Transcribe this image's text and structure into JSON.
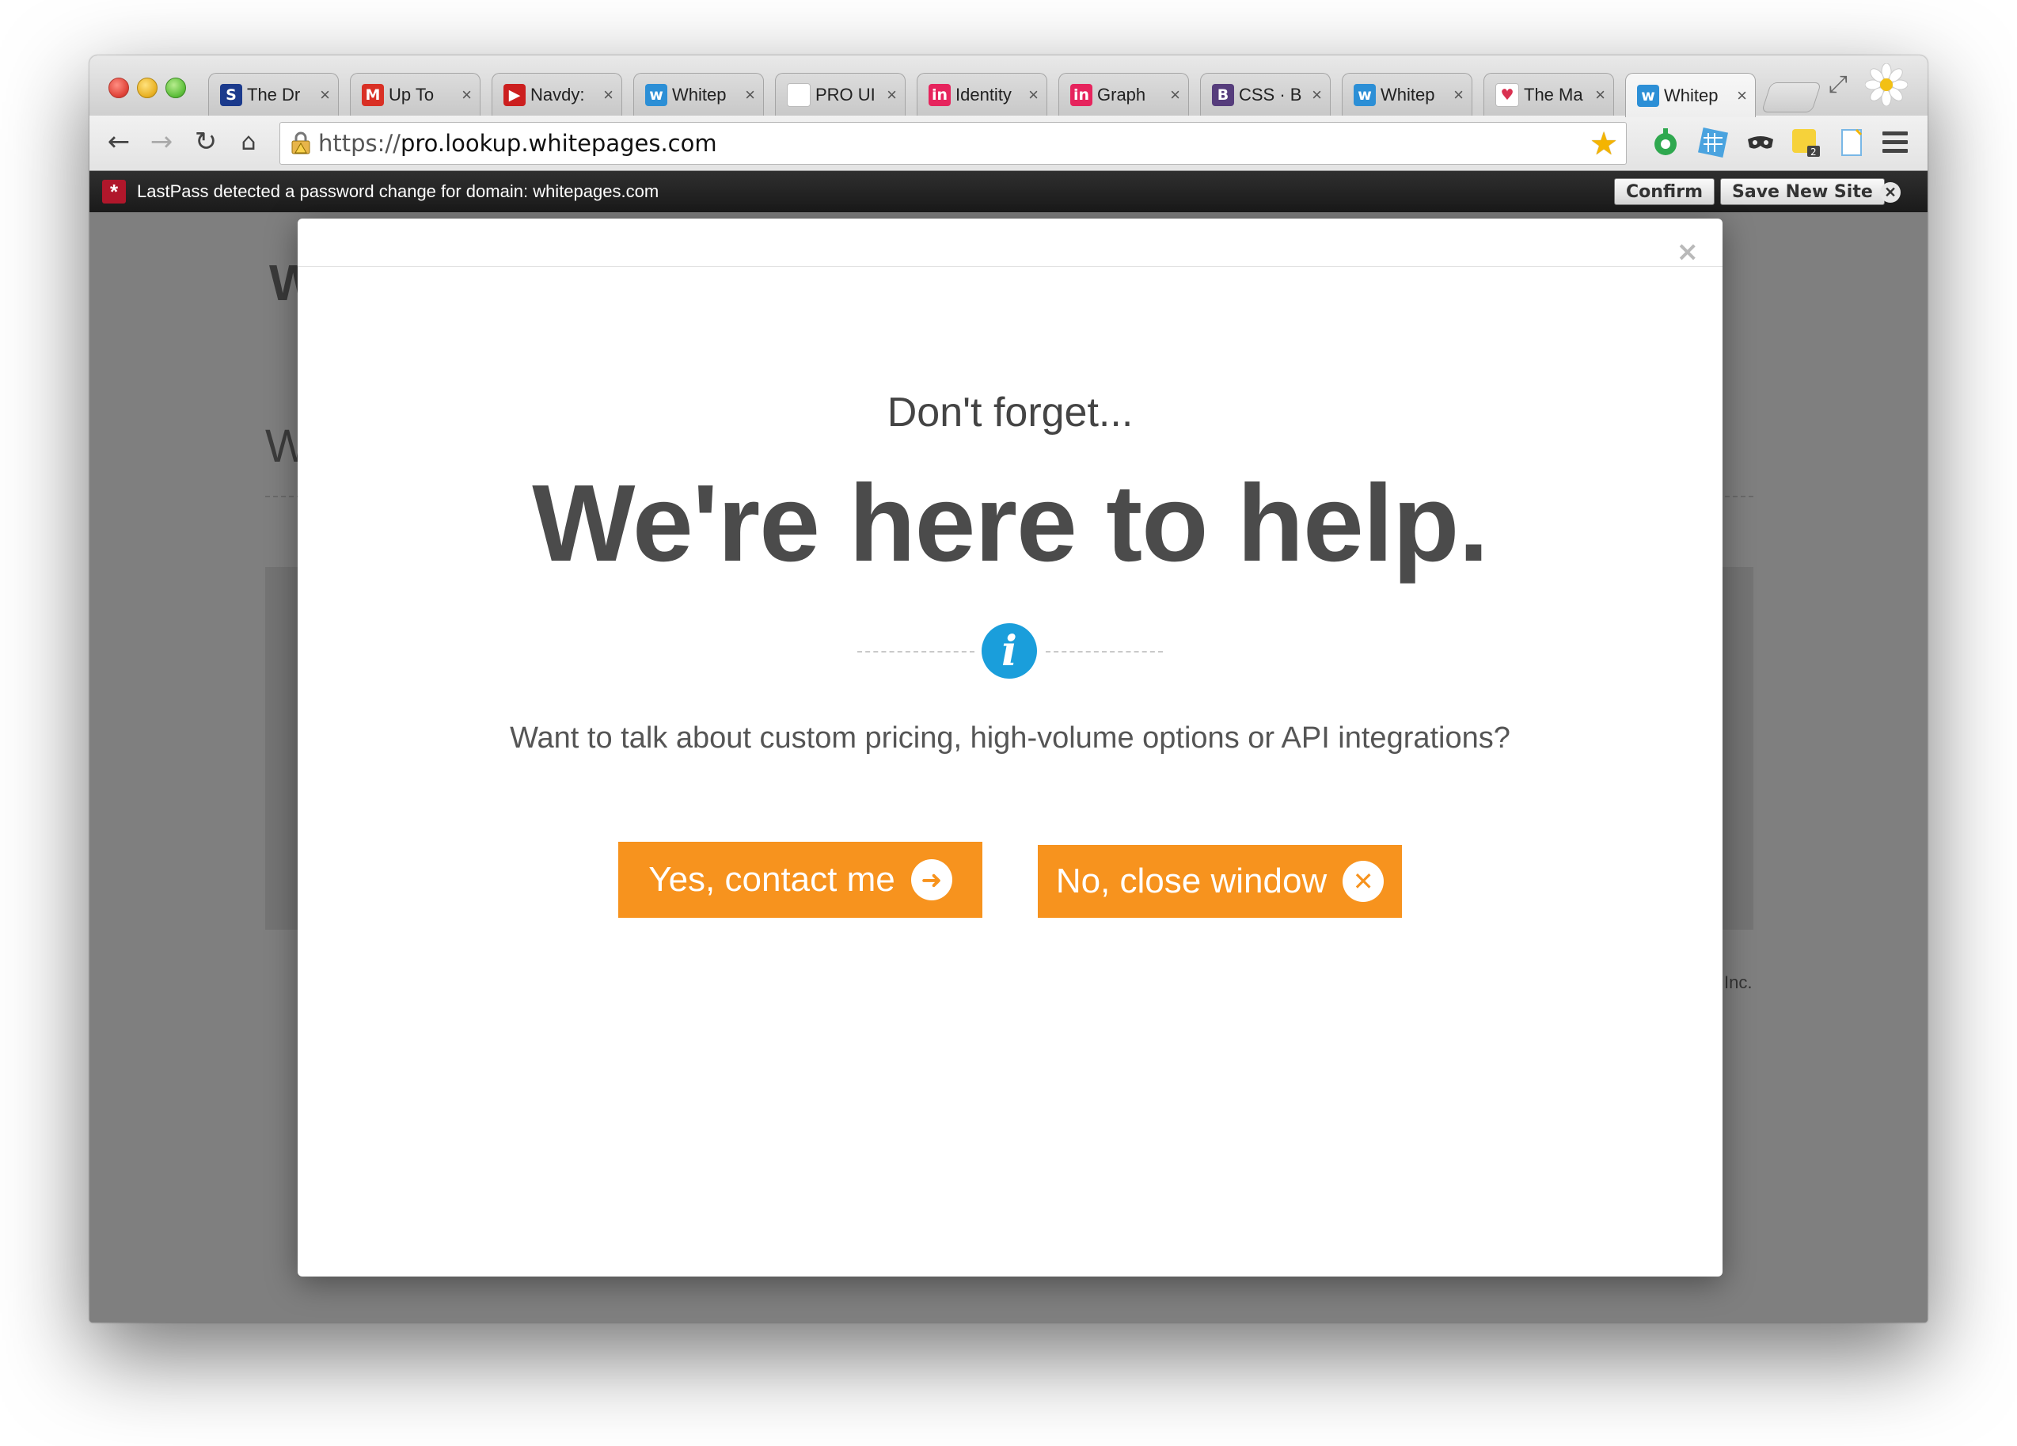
{
  "browser": {
    "tabs": [
      {
        "title": "The Dr",
        "favicon": "s-logo-icon",
        "favicon_color": "#1b3a8c",
        "favicon_glyph": "S"
      },
      {
        "title": "Up To",
        "favicon": "gmail-icon",
        "favicon_color": "#d93025",
        "favicon_glyph": "M"
      },
      {
        "title": "Navdy:",
        "favicon": "youtube-icon",
        "favicon_color": "#cc1f1f",
        "favicon_glyph": "▶"
      },
      {
        "title": "Whitep",
        "favicon": "whitepages-icon",
        "favicon_color": "#2c8fd6",
        "favicon_glyph": "w"
      },
      {
        "title": "PRO UI",
        "favicon": "blank-page-icon",
        "favicon_color": "#ffffff",
        "favicon_glyph": ""
      },
      {
        "title": "Identity",
        "favicon": "invision-icon",
        "favicon_color": "#e6245d",
        "favicon_glyph": "in"
      },
      {
        "title": "Graph",
        "favicon": "invision-icon",
        "favicon_color": "#e6245d",
        "favicon_glyph": "in"
      },
      {
        "title": "CSS · B",
        "favicon": "bootstrap-icon",
        "favicon_color": "#563d7c",
        "favicon_glyph": "B"
      },
      {
        "title": "Whitep",
        "favicon": "whitepages-icon",
        "favicon_color": "#2c8fd6",
        "favicon_glyph": "w"
      },
      {
        "title": "The Ma",
        "favicon": "heart-icon",
        "favicon_color": "#ffffff",
        "favicon_glyph": "♥"
      },
      {
        "title": "Whitep",
        "favicon": "whitepages-icon",
        "favicon_color": "#2c8fd6",
        "favicon_glyph": "w",
        "active": true
      }
    ],
    "url_scheme": "https://",
    "url_host": "pro.lookup.whitepages.com"
  },
  "lastpass": {
    "message": "LastPass detected a password change for domain: whitepages.com",
    "confirm_label": "Confirm",
    "save_label": "Save New Site"
  },
  "background_page": {
    "logo_fragment": "W",
    "heading_fragment": "W",
    "footer_fragment": "Inc."
  },
  "modal": {
    "kicker": "Don't forget...",
    "headline": "We're here to help.",
    "body": "Want to talk about custom pricing, high-volume options or API integrations?",
    "yes_label": "Yes, contact me",
    "no_label": "No, close window",
    "accent_color": "#f7931e",
    "info_color": "#1a9edb"
  }
}
